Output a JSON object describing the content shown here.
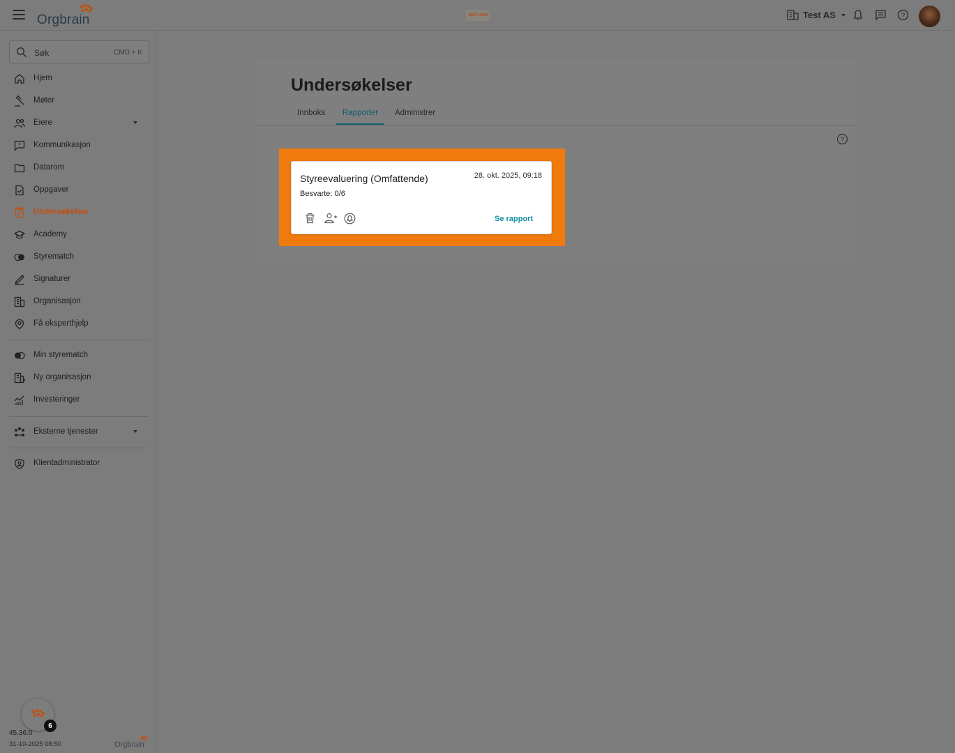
{
  "topbar": {
    "brand": "Orgbrain",
    "center_logo_text": "TEST LOGO",
    "organization": "Test AS"
  },
  "sidebar": {
    "search_placeholder": "Søk",
    "search_shortcut": "CMD + K",
    "items": [
      {
        "label": "Hjem",
        "icon": "home-icon"
      },
      {
        "label": "Møter",
        "icon": "gavel-icon"
      },
      {
        "label": "Eiere",
        "icon": "people-icon"
      },
      {
        "label": "Kommunikasjon",
        "icon": "message-alert-icon"
      },
      {
        "label": "Datarom",
        "icon": "folder-icon"
      },
      {
        "label": "Oppgaver",
        "icon": "task-icon"
      },
      {
        "label": "Undersøkelser",
        "icon": "survey-icon"
      },
      {
        "label": "Academy",
        "icon": "academy-icon"
      },
      {
        "label": "Styrematch",
        "icon": "match-icon"
      },
      {
        "label": "Signaturer",
        "icon": "signature-icon"
      },
      {
        "label": "Organisasjon",
        "icon": "building-icon"
      },
      {
        "label": "Få eksperthjelp",
        "icon": "expert-icon"
      }
    ],
    "items2": [
      {
        "label": "Min styrematch",
        "icon": "match-icon"
      },
      {
        "label": "Ny organisasjon",
        "icon": "building-add-icon"
      },
      {
        "label": "Investeringer",
        "icon": "investment-icon"
      }
    ],
    "external": "Eksterne tjenester",
    "client_admin": "Klientadministrator",
    "fab_badge": "6",
    "version": "45.36.0",
    "version_date": "31-10-2025 08:50",
    "footer_brand": "Orgbrain"
  },
  "main": {
    "title": "Undersøkelser",
    "tabs": [
      "Innboks",
      "Rapporter",
      "Administrer"
    ],
    "active_tab": "Rapporter",
    "card": {
      "title": "Styreevaluering (Omfattende)",
      "date": "28. okt. 2025, 09:18",
      "answered": "Besvarte: 0/6",
      "link": "Se rapport"
    }
  },
  "colors": {
    "accent": "#c0510f",
    "highlight": "#f07a0c",
    "link": "#1391a6",
    "tab_active": "#0f5f6e"
  }
}
